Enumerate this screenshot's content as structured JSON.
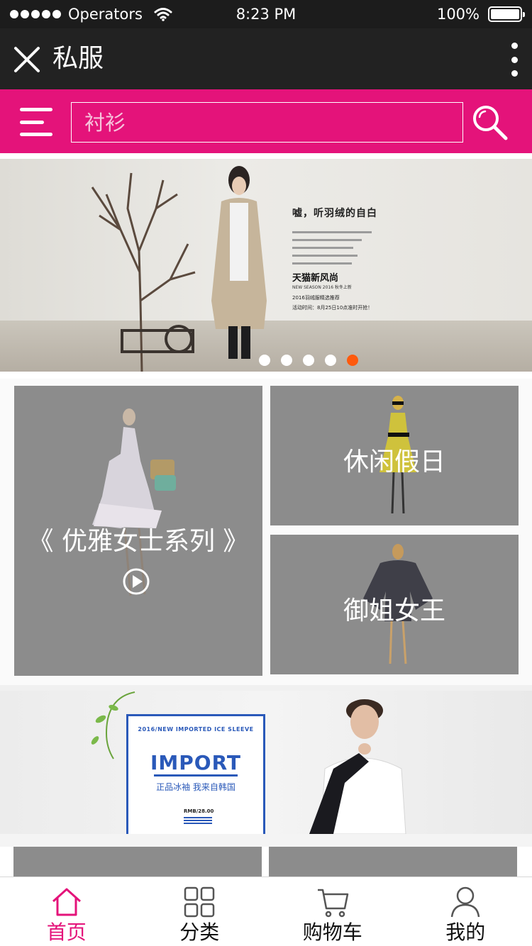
{
  "status_bar": {
    "carrier": "Operators",
    "time": "8:23 PM",
    "battery": "100%",
    "battery_level": 1.0
  },
  "title_bar": {
    "title": "私服",
    "close_icon": "close-icon",
    "more_icon": "more-vertical-icon"
  },
  "search": {
    "menu_icon": "menu-icon",
    "placeholder": "衬衫",
    "search_icon": "search-icon"
  },
  "colors": {
    "accent": "#e4137a",
    "titlebar": "#222222",
    "statusbar": "#1c1c1c",
    "tile_gray": "#8c8c8c",
    "active_dot": "#ff5a0d",
    "import_blue": "#2a59b9"
  },
  "banner": {
    "heading": "嘘，听羽绒的自白",
    "brand": "天猫新风尚",
    "brand_sub": "NEW SEASON 2016 秋冬上新",
    "line1": "2016羽绒服精选推荐",
    "line2": "活动时间：8月25日10点准时开抢！",
    "dots_total": 5,
    "active_dot": 5
  },
  "tiles": [
    {
      "label": "《 优雅女士系列 》",
      "play_icon": "play-circle-icon"
    },
    {
      "label": "休闲假日"
    },
    {
      "label": "御姐女王"
    }
  ],
  "import_banner": {
    "top_text": "2016/NEW IMPORTED ICE SLEEVE",
    "title": "IMPORT",
    "subtitle": "正品冰袖 我来自韩国",
    "price": "RMB/28.00"
  },
  "tab_bar": [
    {
      "label": "首页",
      "icon": "home-icon",
      "active": true
    },
    {
      "label": "分类",
      "icon": "grid-icon",
      "active": false
    },
    {
      "label": "购物车",
      "icon": "cart-icon",
      "active": false
    },
    {
      "label": "我的",
      "icon": "user-icon",
      "active": false
    }
  ]
}
